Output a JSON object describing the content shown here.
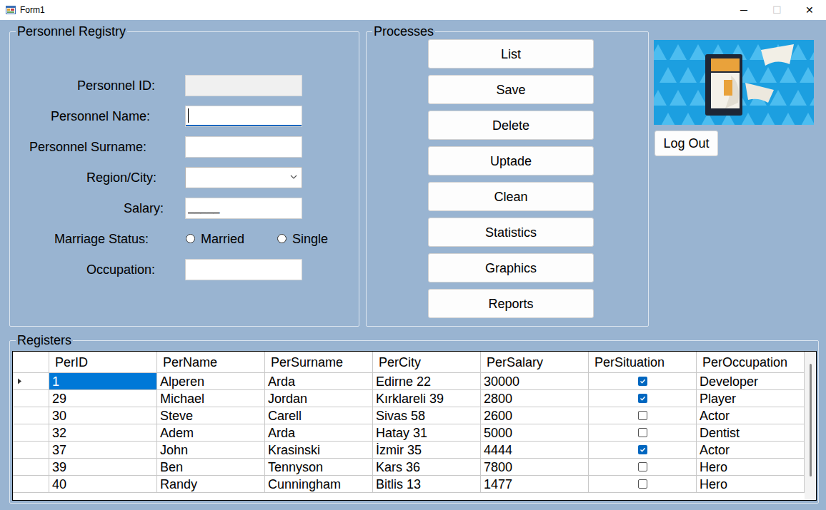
{
  "window": {
    "title": "Form1",
    "controls": [
      {
        "label": "─",
        "disabled": false
      },
      {
        "label": "☐",
        "disabled": true
      },
      {
        "label": "✕",
        "disabled": false
      }
    ]
  },
  "registry": {
    "title": "Personnel Registry",
    "fields": [
      {
        "kind": "text",
        "label": "Personnel ID:",
        "value": "",
        "disabled": true,
        "focused": false
      },
      {
        "kind": "text",
        "label": "Personnel Name:",
        "value": "",
        "disabled": false,
        "focused": true
      },
      {
        "kind": "text",
        "label": "Personnel Surname:",
        "value": "",
        "disabled": false,
        "focused": false
      },
      {
        "kind": "combo",
        "label": "Region/City:",
        "value": "",
        "disabled": false,
        "focused": false
      },
      {
        "kind": "text",
        "label": "Salary:",
        "value": "_____",
        "disabled": false,
        "focused": false
      },
      {
        "kind": "radio",
        "label": "Marriage Status:",
        "options": [
          {
            "label": "Married",
            "selected": false
          },
          {
            "label": "Single",
            "selected": false
          }
        ]
      },
      {
        "kind": "text",
        "label": "Occupation:",
        "value": "",
        "disabled": false,
        "focused": false
      }
    ]
  },
  "processes": {
    "title": "Processes",
    "buttons": [
      "List",
      "Save",
      "Delete",
      "Uptade",
      "Clean",
      "Statistics",
      "Graphics",
      "Reports"
    ]
  },
  "side": {
    "logout": "Log Out"
  },
  "registers": {
    "title": "Registers",
    "columns": [
      "PerID",
      "PerName",
      "PerSurname",
      "PerCity",
      "PerSalary",
      "PerSituation",
      "PerOccupation"
    ],
    "rows": [
      {
        "selected": true,
        "cells": [
          "1",
          "Alperen",
          "Arda",
          "Edirne 22",
          "30000",
          true,
          "Developer"
        ]
      },
      {
        "selected": false,
        "cells": [
          "29",
          "Michael",
          "Jordan",
          "Kırklareli 39",
          "2800",
          true,
          "Player"
        ]
      },
      {
        "selected": false,
        "cells": [
          "30",
          "Steve",
          "Carell",
          "Sivas 58",
          "2600",
          false,
          "Actor"
        ]
      },
      {
        "selected": false,
        "cells": [
          "32",
          "Adem",
          "Arda",
          "Hatay 31",
          "5000",
          false,
          "Dentist"
        ]
      },
      {
        "selected": false,
        "cells": [
          "37",
          "John",
          "Krasinski",
          "İzmir 35",
          "4444",
          true,
          "Actor"
        ]
      },
      {
        "selected": false,
        "cells": [
          "39",
          "Ben",
          "Tennyson",
          "Kars 36",
          "7800",
          false,
          "Hero"
        ]
      },
      {
        "selected": false,
        "cells": [
          "40",
          "Randy",
          "Cunningham",
          "Bitlis 13",
          "1477",
          false,
          "Hero"
        ]
      }
    ]
  }
}
